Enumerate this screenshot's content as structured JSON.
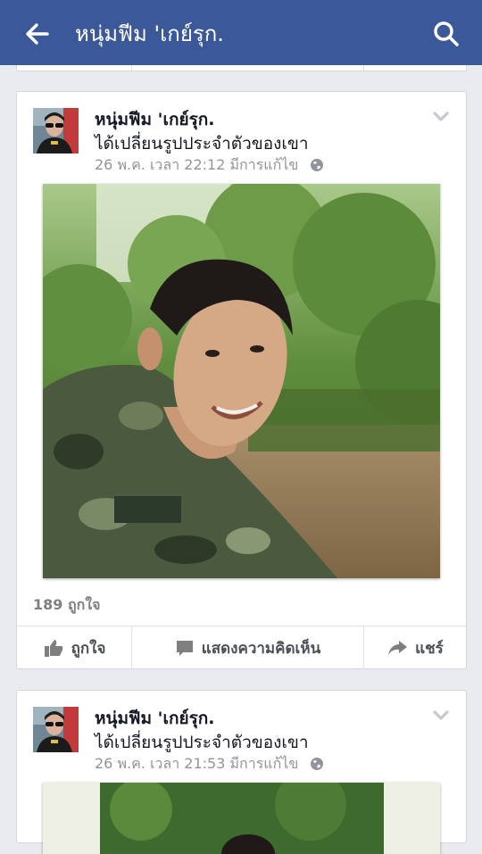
{
  "header": {
    "title": "หนุ่มฟีม 'เกย์รุก.",
    "back_icon": "arrow-left-icon",
    "search_icon": "search-icon",
    "bg_color": "#3b5998"
  },
  "posts": [
    {
      "author": "หนุ่มฟีม 'เกย์รุก.",
      "action": "ได้เปลี่ยนรูปประจำตัวของเขา",
      "timestamp": "26 พ.ค. เวลา 22:12 มีการแก้ไข",
      "privacy_icon": "globe-icon",
      "likes": "189 ถูกใจ",
      "actions": {
        "like": "ถูกใจ",
        "comment": "แสดงความคิดเห็น",
        "share": "แชร์"
      }
    },
    {
      "author": "หนุ่มฟีม 'เกย์รุก.",
      "action": "ได้เปลี่ยนรูปประจำตัวของเขา",
      "timestamp": "26 พ.ค. เวลา 21:53 มีการแก้ไข",
      "privacy_icon": "globe-icon"
    }
  ]
}
